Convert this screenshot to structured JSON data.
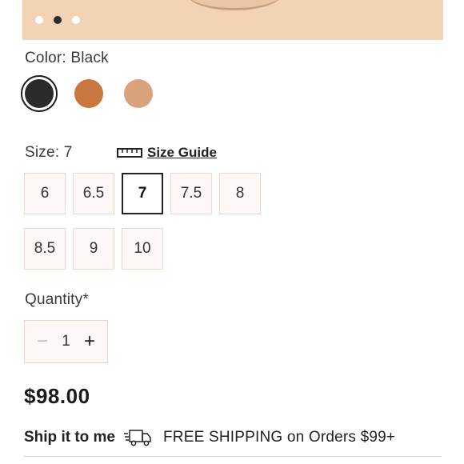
{
  "carousel": {
    "dot_count": 3,
    "active_index": 1
  },
  "color": {
    "label": "Color: Black",
    "swatches": [
      {
        "name": "Black",
        "hex": "#2a2a2a",
        "selected": true
      },
      {
        "name": "Cognac",
        "hex": "#c9763f",
        "selected": false
      },
      {
        "name": "Tan",
        "hex": "#d8a27c",
        "selected": false
      }
    ]
  },
  "size": {
    "label": "Size: 7",
    "guide_label": "Size Guide",
    "options": [
      "6",
      "6.5",
      "7",
      "7.5",
      "8",
      "8.5",
      "9",
      "10"
    ],
    "selected": "7"
  },
  "quantity": {
    "label": "Quantity*",
    "value": "1",
    "minus_symbol": "−",
    "plus_symbol": "+"
  },
  "price": "$98.00",
  "shipping": {
    "option_label": "Ship it to me",
    "promo": "FREE SHIPPING on Orders $99+"
  },
  "colors": {
    "hero_bg": "#f2d3b6",
    "size_bg": "#fdf8f5",
    "size_border": "#e9d9cf"
  }
}
